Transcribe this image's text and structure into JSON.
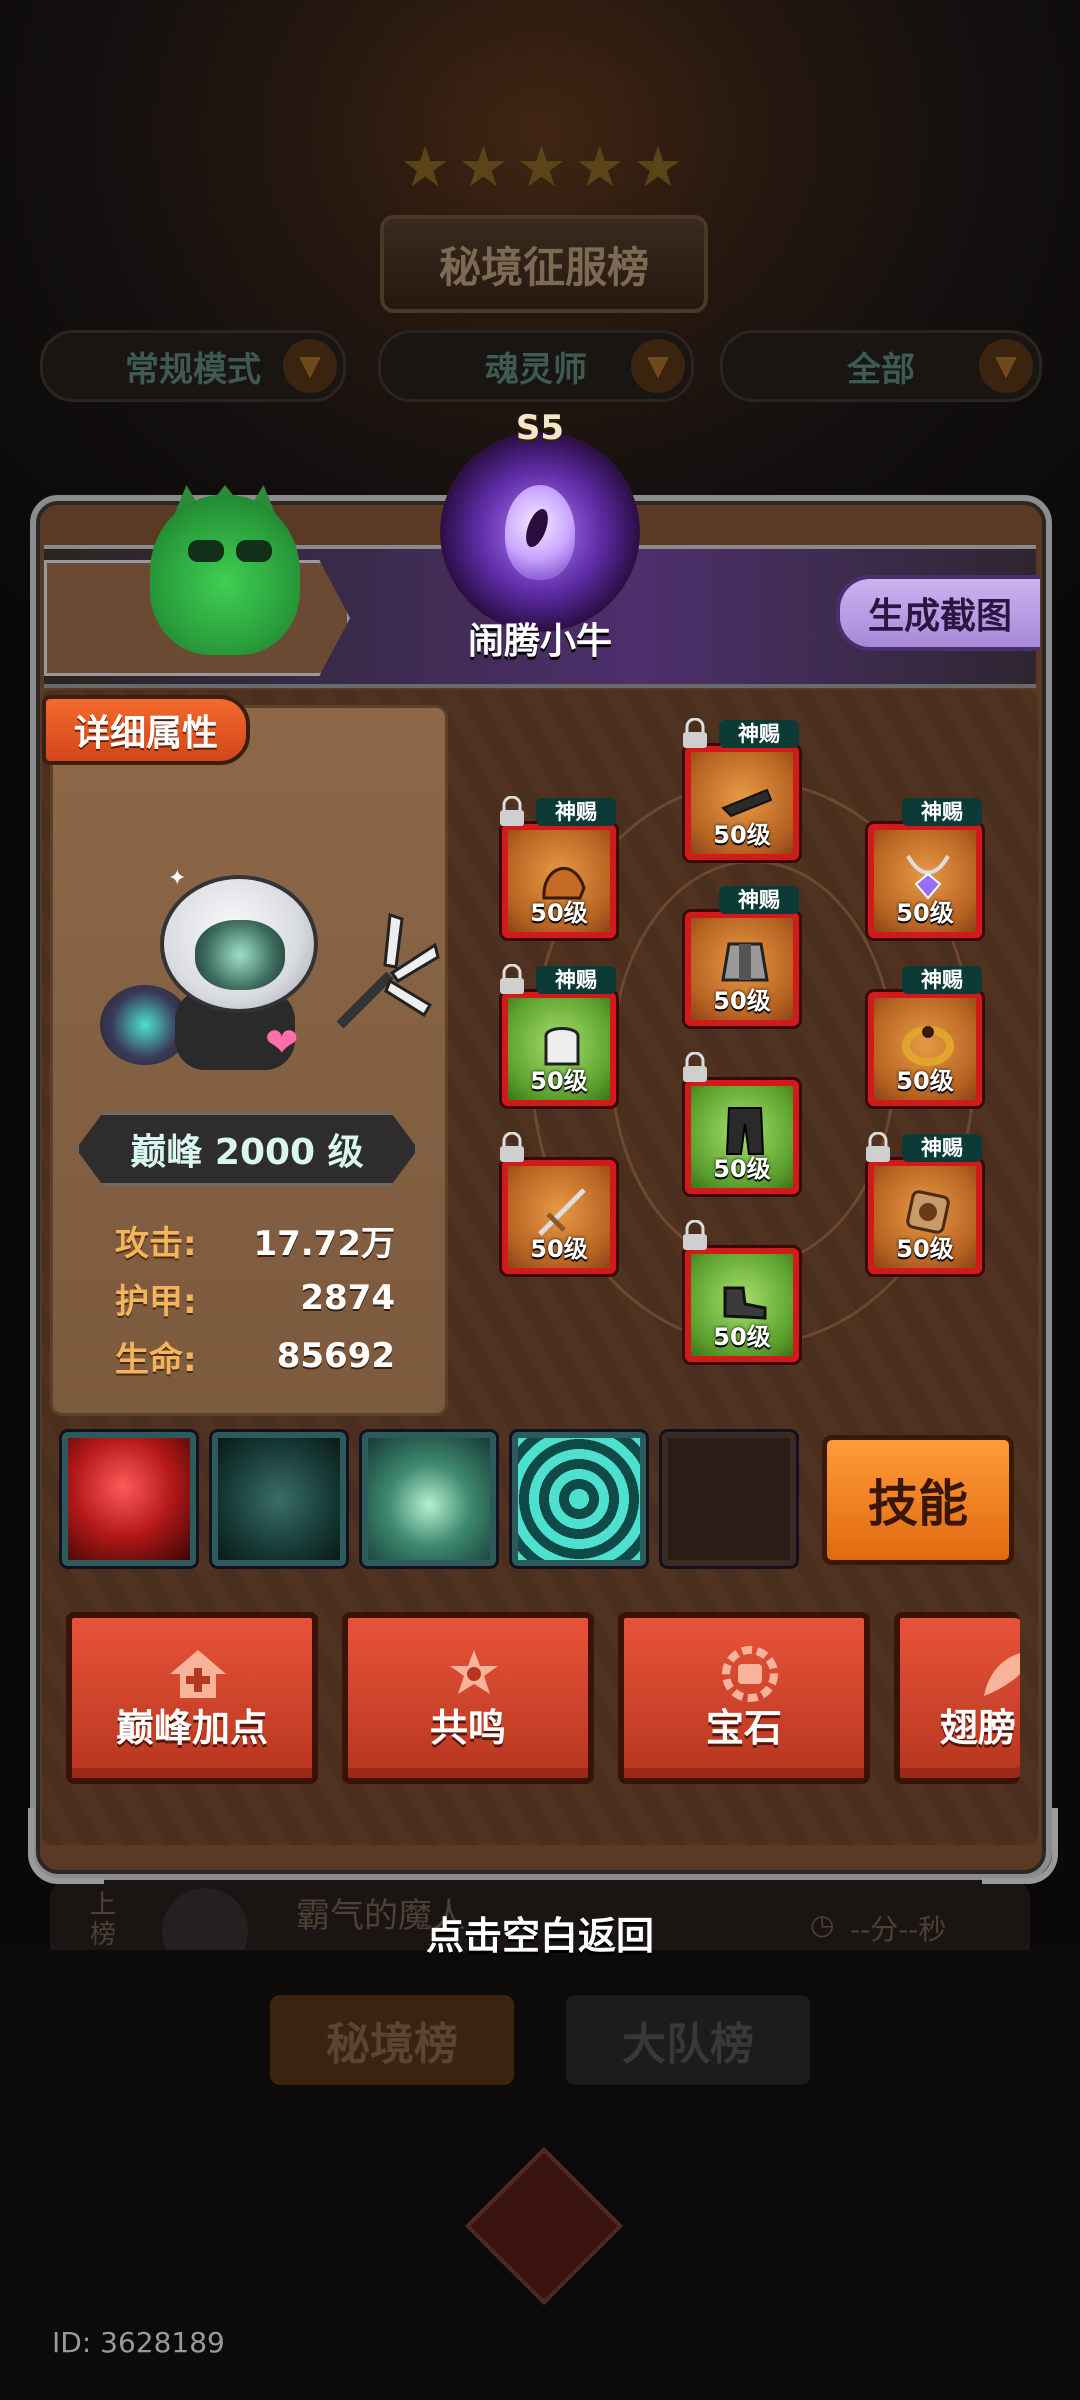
{
  "background": {
    "title": "秘境征服榜",
    "filters": [
      "常规模式",
      "魂灵师",
      "全部"
    ],
    "row_rank_label": "上榜",
    "row_player": "霸气的魔人",
    "row_time": "--分--秒",
    "tabs": [
      "秘境榜",
      "大队榜"
    ]
  },
  "player": {
    "season": "S5",
    "name": "闹腾小牛",
    "screenshot_button": "生成截图"
  },
  "attributes": {
    "tag": "详细属性",
    "level": "巅峰 2000 级",
    "stats": [
      {
        "key": "攻击:",
        "value": "17.72万"
      },
      {
        "key": "护甲:",
        "value": "2874"
      },
      {
        "key": "生命:",
        "value": "85692"
      }
    ]
  },
  "equipment": {
    "divine_label": "神赐",
    "slots": [
      {
        "id": "cape",
        "level": "50级",
        "rarity": "orange",
        "divine": true,
        "locked": true
      },
      {
        "id": "helmet",
        "level": "50级",
        "rarity": "orange",
        "divine": true,
        "locked": true
      },
      {
        "id": "necklace",
        "level": "50级",
        "rarity": "orange",
        "divine": true,
        "locked": false
      },
      {
        "id": "armor",
        "level": "50级",
        "rarity": "orange",
        "divine": true,
        "locked": false
      },
      {
        "id": "gloves",
        "level": "50级",
        "rarity": "green",
        "divine": true,
        "locked": true
      },
      {
        "id": "ring",
        "level": "50级",
        "rarity": "orange",
        "divine": true,
        "locked": false
      },
      {
        "id": "pants",
        "level": "50级",
        "rarity": "green",
        "divine": false,
        "locked": true
      },
      {
        "id": "weapon",
        "level": "50级",
        "rarity": "orange",
        "divine": false,
        "locked": true
      },
      {
        "id": "charm",
        "level": "50级",
        "rarity": "orange",
        "divine": true,
        "locked": true
      },
      {
        "id": "boots",
        "level": "50级",
        "rarity": "green",
        "divine": false,
        "locked": true
      }
    ]
  },
  "skills": {
    "button": "技能",
    "icons": [
      "blood-orb-icon",
      "scythe-slash-icon",
      "spirit-wings-icon",
      "vortex-icon",
      "empty-slot"
    ]
  },
  "functions": [
    "巅峰加点",
    "共鸣",
    "宝石",
    "翅膀"
  ],
  "back_hint": "点击空白返回",
  "user_id": "ID: 3628189"
}
